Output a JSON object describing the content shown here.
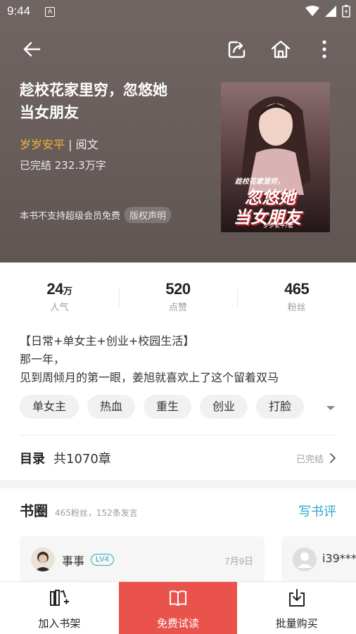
{
  "status_bar": {
    "time": "9:44",
    "notification_letter": "A"
  },
  "nav": {
    "back_icon": "back-arrow-icon",
    "share_icon": "share-icon",
    "home_icon": "home-icon",
    "more_icon": "more-vertical-icon"
  },
  "book": {
    "title_line1": "趁校花家里穷，忽悠她",
    "title_line2": "当女朋友",
    "author": "岁岁安平",
    "separator": " | ",
    "publisher": "阅文",
    "status": "已完结 232.3万字",
    "vip_note": "本书不支持超级会员免费",
    "copyright_label": "版权声明",
    "cover_title_small": "趁校花家里穷，",
    "cover_title_big1": "忽悠她",
    "cover_title_big2": "当女朋友",
    "cover_author": "岁岁安平/著"
  },
  "stats": [
    {
      "value": "24",
      "unit": "万",
      "label": "人气"
    },
    {
      "value": "520",
      "unit": "",
      "label": "点赞"
    },
    {
      "value": "465",
      "unit": "",
      "label": "粉丝"
    }
  ],
  "intro": {
    "line1": "【日常+单女主+创业+校园生活】",
    "line2": "那一年，",
    "line3": "见到周倾月的第一眼，姜旭就喜欢上了这个留着双马"
  },
  "tags": [
    "单女主",
    "热血",
    "重生",
    "创业",
    "打脸"
  ],
  "toc": {
    "title": "目录",
    "count": "共1070章",
    "status": "已完结"
  },
  "circle": {
    "title": "书圈",
    "subtitle": "465粉丝，152条发言",
    "write_review": "写书评",
    "reviews": [
      {
        "name": "事事",
        "level": "LV4",
        "date": "7月9日"
      },
      {
        "name": "i39****",
        "level": "",
        "date": ""
      }
    ]
  },
  "bottom_bar": {
    "add_shelf": "加入书架",
    "free_read": "免费试读",
    "bulk_buy": "批量购买"
  },
  "colors": {
    "accent_red": "#e9534b",
    "author_gold": "#f3b13b",
    "link_blue": "#2aa6c9"
  }
}
